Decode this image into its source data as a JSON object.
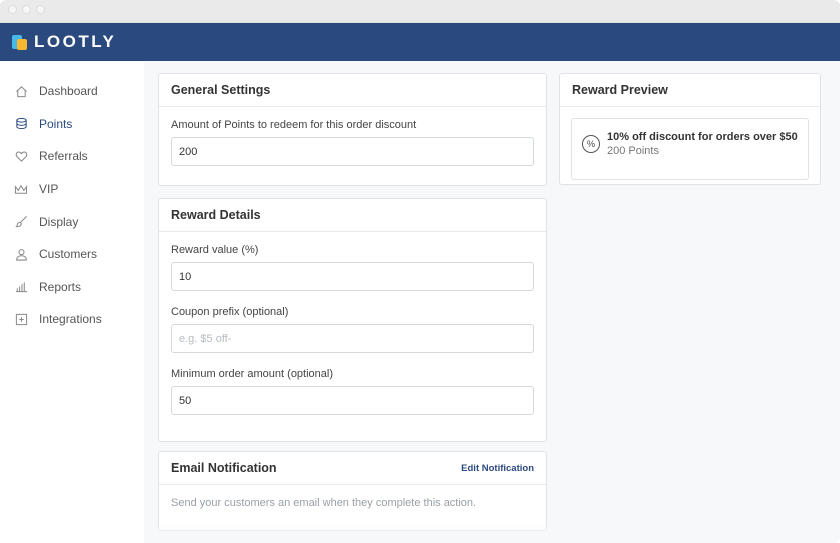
{
  "app": {
    "brand": "LOOTLY"
  },
  "sidebar": {
    "items": [
      {
        "label": "Dashboard",
        "icon": "home-icon"
      },
      {
        "label": "Points",
        "icon": "database-icon",
        "active": true
      },
      {
        "label": "Referrals",
        "icon": "heart-icon"
      },
      {
        "label": "VIP",
        "icon": "crown-icon"
      },
      {
        "label": "Display",
        "icon": "brush-icon"
      },
      {
        "label": "Customers",
        "icon": "user-icon"
      },
      {
        "label": "Reports",
        "icon": "bar-chart-icon"
      },
      {
        "label": "Integrations",
        "icon": "plugin-icon"
      }
    ]
  },
  "general_settings": {
    "title": "General Settings",
    "points_label": "Amount of Points to redeem for this order discount",
    "points_value": "200"
  },
  "reward_details": {
    "title": "Reward Details",
    "reward_value_label": "Reward value (%)",
    "reward_value": "10",
    "coupon_prefix_label": "Coupon prefix (optional)",
    "coupon_prefix_placeholder": "e.g. $5 off-",
    "min_order_label": "Minimum order amount (optional)",
    "min_order_value": "50"
  },
  "email_notification": {
    "title": "Email Notification",
    "edit_link": "Edit Notification",
    "description": "Send your customers an email when they complete this action."
  },
  "reward_preview": {
    "title": "Reward Preview",
    "reward_title": "10% off discount for orders over $50",
    "reward_points": "200 Points",
    "icon_glyph": "%"
  },
  "colors": {
    "brand": "#2a4a7f",
    "logo_blue": "#45b9e8",
    "logo_yellow": "#f7b731"
  }
}
